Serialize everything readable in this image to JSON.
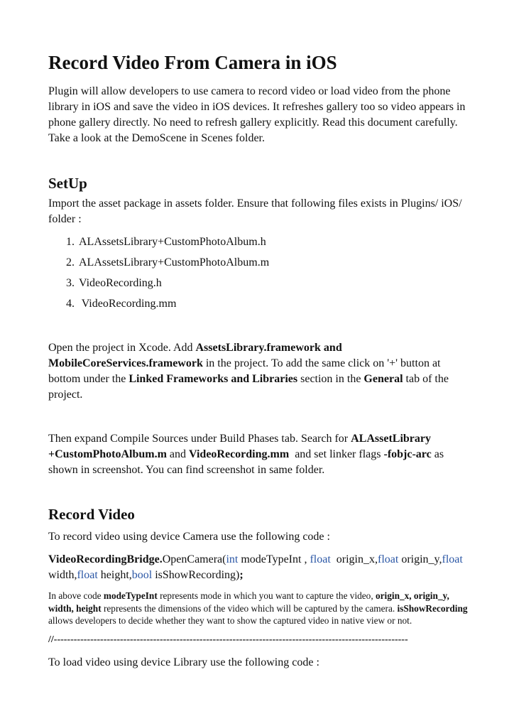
{
  "title": "Record Video From Camera in iOS",
  "intro": "Plugin will allow developers to use camera to record video or load video from the phone library in iOS and save the video in iOS devices. It refreshes gallery too so video appears in phone gallery directly. No need to refresh gallery explicitly. Read this document carefully. Take a look at the DemoScene in Scenes folder.",
  "setup": {
    "heading": "SetUp",
    "text": "Import the asset package in assets folder. Ensure that following files exists in Plugins/ iOS/ folder :",
    "files": [
      "ALAssetsLibrary+CustomPhotoAlbum.h",
      "ALAssetsLibrary+CustomPhotoAlbum.m",
      "VideoRecording.h",
      " VideoRecording.mm"
    ]
  },
  "xcode_para": {
    "t1": "Open the project in Xcode. Add ",
    "b1": "AssetsLibrary.framework and MobileCoreServices.framework",
    "t2": " in the project. To add the same click on '+' button at bottom under the ",
    "b2": "Linked Frameworks and Libraries",
    "t3": " section in the ",
    "b3": "General",
    "t4": " tab of the project."
  },
  "compile_para": {
    "t1": "Then expand Compile Sources under Build Phases tab. Search for ",
    "b1": "ALAssetLibrary +CustomPhotoAlbum.m",
    "t2": " and ",
    "b2": "VideoRecording.mm",
    "t3": "  and set linker flags ",
    "b3": "-fobjc-arc",
    "t4": " as shown in screenshot. You can find screenshot in same folder."
  },
  "record_video": {
    "heading": "Record Video",
    "text": "To record video using device Camera use the following code :",
    "code": {
      "class_name": "VideoRecordingBridge.",
      "method": "OpenCamera(",
      "kw_int": "int",
      "p1": " modeTypeInt , ",
      "kw_float1": "float",
      "p2": "  origin_x,",
      "kw_float2": "float",
      "p3": " origin_y,",
      "kw_float3": "float",
      "p4": " width,",
      "kw_float4": "float",
      "p5": " height,",
      "kw_bool": "bool",
      "p6": " isShowRecording)",
      "end": ";"
    },
    "note": {
      "t1": "In above code ",
      "b1": "modeTypeInt",
      "t2": " represents mode in which you want to capture the video, ",
      "b2": "origin_x, origin_y, width, height",
      "t3": " represents the dimensions of the video which will be captured by the camera. ",
      "b3": "isShowRecording",
      "t4": " allows developers to decide whether they want to show the captured video in native view or not."
    },
    "divider": "//-----------------------------------------------------------------------------------------------------------",
    "load_text": "To load video using device Library use the following code :"
  },
  "colors": {
    "keyword": "#2a56a5",
    "text": "#111111"
  }
}
